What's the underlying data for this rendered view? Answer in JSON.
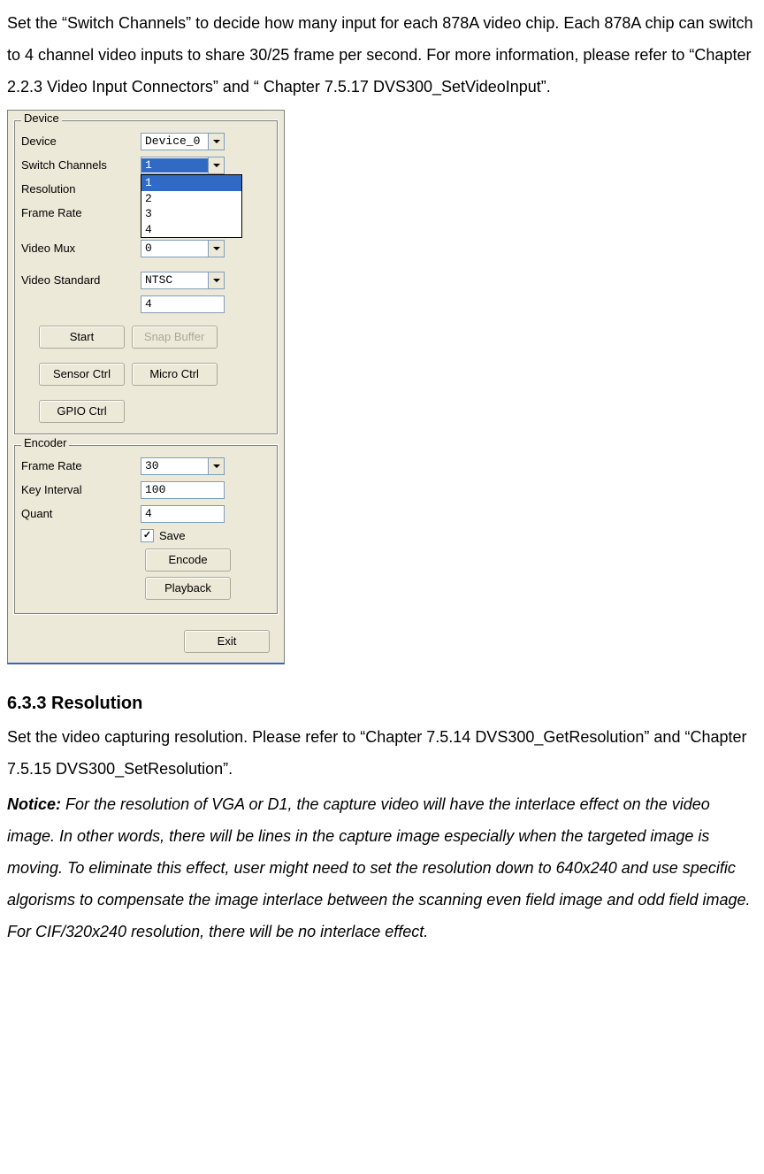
{
  "intro_paragraph": "Set the “Switch Channels” to decide how many input for each 878A video chip. Each 878A chip can switch to 4 channel video inputs to share 30/25 frame per second. For more information, please refer to “Chapter 2.2.3 Video Input Connectors” and “ Chapter 7.5.17 DVS300_SetVideoInput”.",
  "dialog": {
    "device_group": {
      "title": "Device",
      "rows": {
        "device": {
          "label": "Device",
          "value": "Device_0"
        },
        "switch_channels": {
          "label": "Switch Channels",
          "value": "1",
          "options": [
            "1",
            "2",
            "3",
            "4"
          ]
        },
        "resolution": {
          "label": "Resolution"
        },
        "frame_rate": {
          "label": "Frame Rate"
        },
        "video_mux": {
          "label": "Video Mux",
          "value": "0"
        },
        "video_standard": {
          "label": "Video Standard",
          "value": "NTSC"
        },
        "extra_value": "4"
      },
      "buttons": {
        "start": "Start",
        "snap_buffer": "Snap Buffer",
        "sensor_ctrl": "Sensor Ctrl",
        "micro_ctrl": "Micro Ctrl",
        "gpio_ctrl": "GPIO Ctrl"
      }
    },
    "encoder_group": {
      "title": "Encoder",
      "rows": {
        "frame_rate": {
          "label": "Frame Rate",
          "value": "30"
        },
        "key_interval": {
          "label": "Key Interval",
          "value": "100"
        },
        "quant": {
          "label": "Quant",
          "value": "4"
        }
      },
      "save_label": "Save",
      "save_checked": true,
      "buttons": {
        "encode": "Encode",
        "playback": "Playback"
      }
    },
    "exit": "Exit"
  },
  "section_heading": "6.3.3 Resolution",
  "section_body": "Set the video capturing resolution. Please refer to “Chapter 7.5.14 DVS300_GetResolution” and “Chapter 7.5.15 DVS300_SetResolution”.",
  "notice_label": "Notice:",
  "notice_body": " For the resolution of VGA or D1, the capture video will have the interlace effect on the video image. In other words, there will be lines in the capture image especially when the targeted image is moving. To eliminate this effect, user might need to set the resolution down to 640x240 and use specific algorisms to compensate the image interlace between the scanning even field image and odd field image. For CIF/320x240 resolution, there will be no interlace effect."
}
